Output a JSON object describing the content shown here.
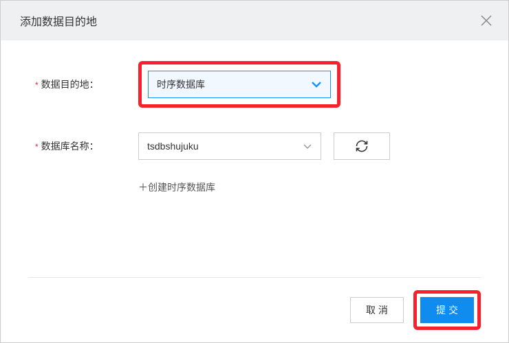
{
  "dialog": {
    "title": "添加数据目的地"
  },
  "form": {
    "destination": {
      "label": "数据目的地：",
      "value": "时序数据库"
    },
    "dbname": {
      "label": "数据库名称：",
      "value": "tsdbshujuku"
    },
    "createLink": "＋创建时序数据库"
  },
  "footer": {
    "cancel": "取消",
    "submit": "提交"
  }
}
